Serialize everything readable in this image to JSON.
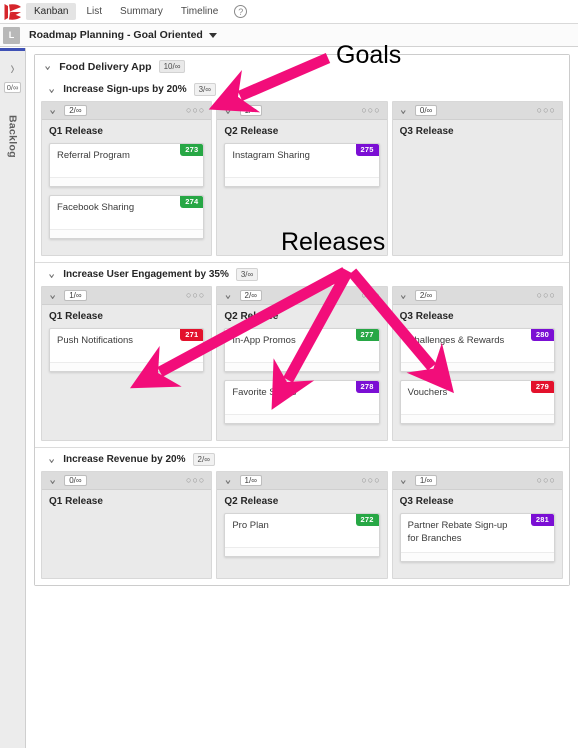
{
  "app": {
    "logo_icon": "kanbanize-k-logo",
    "brand_color": "#d6252b"
  },
  "topnav": {
    "tabs": [
      {
        "label": "Kanban",
        "active": true
      },
      {
        "label": "List",
        "active": false
      },
      {
        "label": "Summary",
        "active": false
      },
      {
        "label": "Timeline",
        "active": false
      }
    ],
    "help_icon": "question-mark-icon",
    "help_label": "?"
  },
  "titlebar": {
    "avatar_letter": "L",
    "title": "Roadmap Planning - Goal Oriented",
    "dropdown_icon": "caret-down-icon"
  },
  "backlog_lane": {
    "label": "Backlog",
    "wip": "0/∞",
    "chevron_icon": "chevron-right-icon",
    "accent_color": "#3f51b5"
  },
  "annotations": {
    "color": "#f20d7a",
    "items": [
      {
        "id": "goals",
        "text": "Goals"
      },
      {
        "id": "releases",
        "text": "Releases"
      }
    ]
  },
  "badge_colors": {
    "green": "#27a745",
    "purple": "#7b0fd4",
    "red": "#e3112c"
  },
  "project": {
    "title": "Food Delivery App",
    "wip": "10/∞",
    "chevron_icon": "chevron-down-icon",
    "goals": [
      {
        "title": "Increase Sign-ups by 20%",
        "wip": "3/∞",
        "columns": [
          {
            "name": "Q1 Release",
            "wip": "2/∞",
            "menu_icon": "more-options-icon",
            "cards": [
              {
                "title": "Referral Program",
                "id": "273",
                "color": "#27a745"
              },
              {
                "title": "Facebook Sharing",
                "id": "274",
                "color": "#27a745"
              }
            ]
          },
          {
            "name": "Q2 Release",
            "wip": "1/∞",
            "menu_icon": "more-options-icon",
            "cards": [
              {
                "title": "Instagram Sharing",
                "id": "275",
                "color": "#7b0fd4"
              }
            ]
          },
          {
            "name": "Q3 Release",
            "wip": "0/∞",
            "menu_icon": "more-options-icon",
            "cards": []
          }
        ]
      },
      {
        "title": "Increase User Engagement by 35%",
        "wip": "3/∞",
        "columns": [
          {
            "name": "Q1 Release",
            "wip": "1/∞",
            "menu_icon": "more-options-icon",
            "cards": [
              {
                "title": "Push Notifications",
                "id": "271",
                "color": "#e3112c"
              }
            ]
          },
          {
            "name": "Q2 Release",
            "wip": "2/∞",
            "menu_icon": "more-options-icon",
            "cards": [
              {
                "title": "In-App Promos",
                "id": "277",
                "color": "#27a745"
              },
              {
                "title": "Favorite Shops",
                "id": "278",
                "color": "#7b0fd4"
              }
            ]
          },
          {
            "name": "Q3 Release",
            "wip": "2/∞",
            "menu_icon": "more-options-icon",
            "cards": [
              {
                "title": "Challenges & Rewards",
                "id": "280",
                "color": "#7b0fd4"
              },
              {
                "title": "Vouchers",
                "id": "279",
                "color": "#e3112c"
              }
            ]
          }
        ]
      },
      {
        "title": "Increase Revenue by 20%",
        "wip": "2/∞",
        "columns": [
          {
            "name": "Q1 Release",
            "wip": "0/∞",
            "menu_icon": "more-options-icon",
            "cards": []
          },
          {
            "name": "Q2 Release",
            "wip": "1/∞",
            "menu_icon": "more-options-icon",
            "cards": [
              {
                "title": "Pro Plan",
                "id": "272",
                "color": "#27a745"
              }
            ]
          },
          {
            "name": "Q3 Release",
            "wip": "1/∞",
            "menu_icon": "more-options-icon",
            "cards": [
              {
                "title": "Partner Rebate Sign-up for Branches",
                "id": "281",
                "color": "#7b0fd4"
              }
            ]
          }
        ]
      }
    ]
  }
}
